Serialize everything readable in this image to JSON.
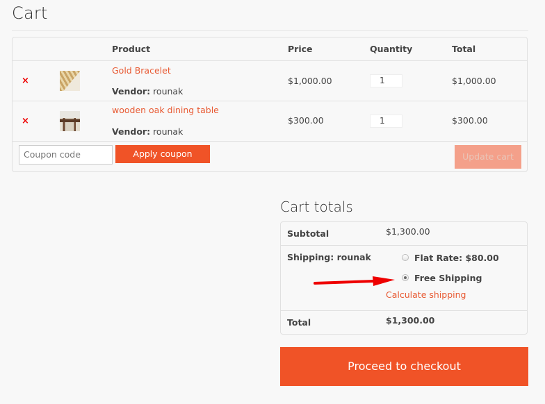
{
  "page": {
    "title": "Cart"
  },
  "cart": {
    "columns": {
      "remove": "",
      "thumbnail": "",
      "product": "Product",
      "price": "Price",
      "quantity": "Quantity",
      "total": "Total"
    },
    "items": [
      {
        "remove_icon": "×",
        "thumbnail": "gold-bracelet-thumbnail",
        "name": "Gold Bracelet",
        "vendor_label": "Vendor:",
        "vendor": "rounak",
        "price": "$1,000.00",
        "quantity": "1",
        "total": "$1,000.00"
      },
      {
        "remove_icon": "×",
        "thumbnail": "wooden-oak-dining-table-thumbnail",
        "name": "wooden oak dining table",
        "vendor_label": "Vendor:",
        "vendor": "rounak",
        "price": "$300.00",
        "quantity": "1",
        "total": "$300.00"
      }
    ],
    "coupon": {
      "placeholder": "Coupon code",
      "value": ""
    },
    "apply_coupon_label": "Apply coupon",
    "update_cart_label": "Update cart"
  },
  "totals": {
    "title": "Cart totals",
    "subtotal_label": "Subtotal",
    "subtotal": "$1,300.00",
    "shipping_label": "Shipping: rounak",
    "shipping_options": [
      {
        "label": "Flat Rate: $80.00",
        "selected": false
      },
      {
        "label": "Free Shipping",
        "selected": true
      }
    ],
    "calculate_shipping_label": "Calculate shipping",
    "total_label": "Total",
    "total": "$1,300.00",
    "checkout_label": "Proceed to checkout"
  },
  "annotation": {
    "arrow_color": "#ee0000",
    "points_to": "Free Shipping"
  },
  "colors": {
    "accent": "#f05327",
    "link": "#e85a33",
    "remove": "#ee0000",
    "update_disabled": "#f4a08a",
    "background": "#f8f8f8"
  }
}
